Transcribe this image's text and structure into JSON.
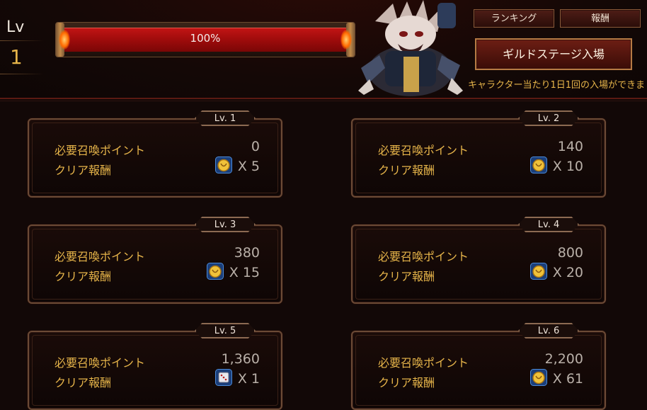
{
  "level": {
    "label": "Lv",
    "value": "1"
  },
  "progress": {
    "text": "100%",
    "fraction": 1.0
  },
  "header": {
    "ranking_label": "ランキング",
    "reward_label": "報酬",
    "enter_label": "ギルドステージ入場",
    "notice": "キャラクター当たり1日1回の入場ができま"
  },
  "labels": {
    "need": "必要召喚ポイント",
    "reward": "クリア報酬"
  },
  "stages": [
    {
      "lv": "Lv. 1",
      "points": "0",
      "icon": "gold-coin-icon",
      "count": "X 5"
    },
    {
      "lv": "Lv. 2",
      "points": "140",
      "icon": "gold-coin-icon",
      "count": "X 10"
    },
    {
      "lv": "Lv. 3",
      "points": "380",
      "icon": "gold-coin-icon",
      "count": "X 15"
    },
    {
      "lv": "Lv. 4",
      "points": "800",
      "icon": "gold-coin-icon",
      "count": "X 20"
    },
    {
      "lv": "Lv. 5",
      "points": "1,360",
      "icon": "dice-box-icon",
      "count": "X 1"
    },
    {
      "lv": "Lv. 6",
      "points": "2,200",
      "icon": "gold-coin-icon",
      "count": "X 61"
    }
  ],
  "colors": {
    "accent_gold": "#e7b54a",
    "bar_red": "#b31010",
    "frame": "#6b4a35"
  }
}
